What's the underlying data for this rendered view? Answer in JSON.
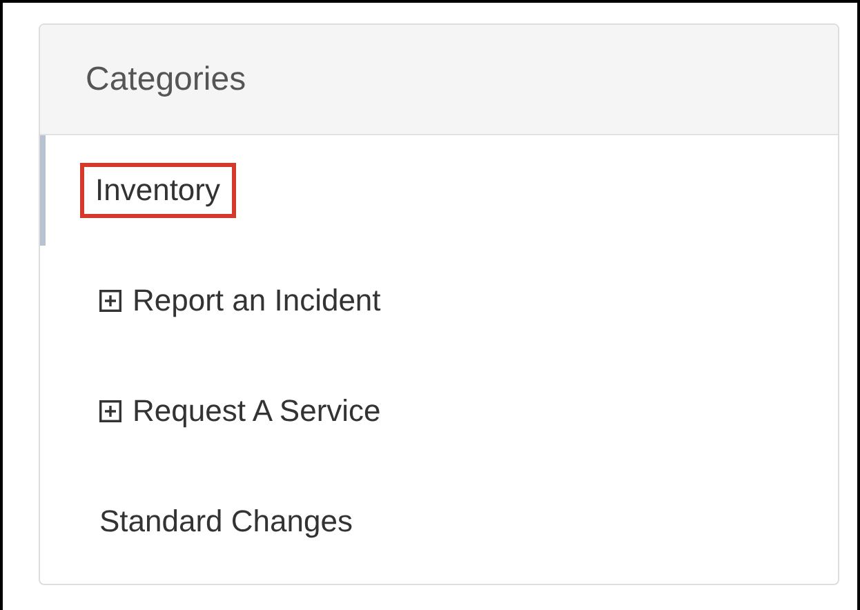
{
  "panel": {
    "title": "Categories",
    "items": [
      {
        "label": "Inventory",
        "kind": "link",
        "selected": true,
        "highlighted": true
      },
      {
        "label": "Report an Incident",
        "kind": "group",
        "selected": false,
        "highlighted": false
      },
      {
        "label": "Request A Service",
        "kind": "group",
        "selected": false,
        "highlighted": false
      },
      {
        "label": "Standard Changes",
        "kind": "link",
        "selected": false,
        "highlighted": false
      }
    ]
  }
}
